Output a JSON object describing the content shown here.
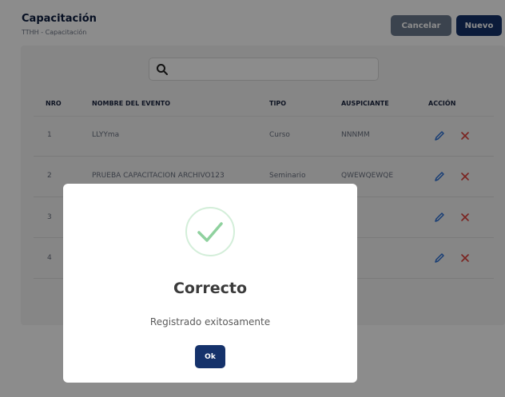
{
  "header": {
    "title": "Capacitación",
    "breadcrumb": "TTHH - Capacitación",
    "cancel_label": "Cancelar",
    "new_label": "Nuevo"
  },
  "search": {
    "value": "",
    "placeholder": ""
  },
  "table": {
    "columns": [
      "NRO",
      "NOMBRE DEL EVENTO",
      "TIPO",
      "AUSPICIANTE",
      "ACCIÓN"
    ],
    "rows": [
      {
        "nro": "1",
        "nombre": "LLYYma",
        "tipo": "Curso",
        "auspiciante": "NNNMM"
      },
      {
        "nro": "2",
        "nombre": "PRUEBA CAPACITACION ARCHIVO123",
        "tipo": "Seminario",
        "auspiciante": "QWEWQEWQE"
      },
      {
        "nro": "3",
        "nombre": "",
        "tipo": "",
        "auspiciante": ""
      },
      {
        "nro": "4",
        "nombre": "",
        "tipo": "",
        "auspiciante": ""
      }
    ],
    "action_icons": [
      "pencil-icon",
      "close-icon"
    ]
  },
  "modal": {
    "icon": "check-circle-icon",
    "title": "Correcto",
    "message": "Registrado exitosamente",
    "ok_label": "Ok"
  },
  "colors": {
    "primary": "#15326b",
    "cancel": "#6c7a8e",
    "edit": "#2b6fd6",
    "delete": "#e0413b",
    "success": "#8fd19e"
  }
}
